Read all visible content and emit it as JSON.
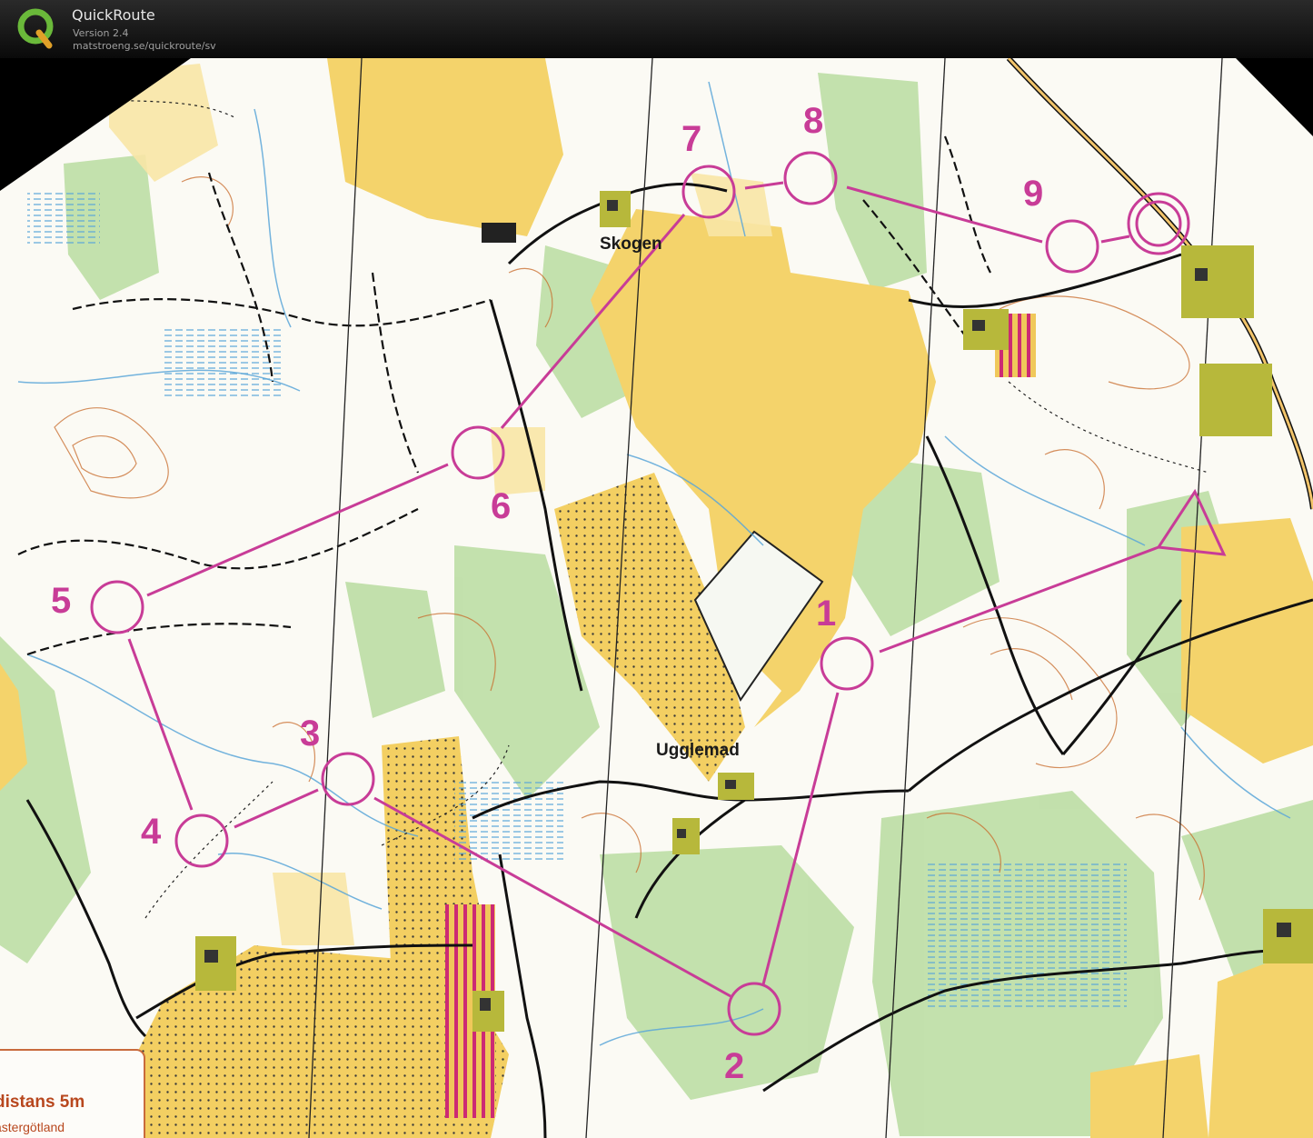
{
  "app": {
    "title": "QuickRoute",
    "version": "Version 2.4",
    "url": "matstroeng.se/quickroute/sv",
    "logo_letter": "Q"
  },
  "map": {
    "place_names": [
      {
        "id": "skogen",
        "label": "Skogen"
      },
      {
        "id": "ugglemad",
        "label": "Ugglemad"
      }
    ],
    "controls": [
      {
        "label": "1"
      },
      {
        "label": "2"
      },
      {
        "label": "3"
      },
      {
        "label": "4"
      },
      {
        "label": "5"
      },
      {
        "label": "6"
      },
      {
        "label": "7"
      },
      {
        "label": "8"
      },
      {
        "label": "9"
      }
    ],
    "legend": {
      "title": "distans 5m",
      "subtitle": "ästergötland"
    },
    "colors": {
      "course": "#c83c97",
      "open_land": "#f4d36b",
      "rough_open": "#f8e6a6",
      "green": "#b9dca0",
      "water": "#5aa6d8",
      "contour": "#c86a2a",
      "paper": "#fbfaf4"
    }
  }
}
